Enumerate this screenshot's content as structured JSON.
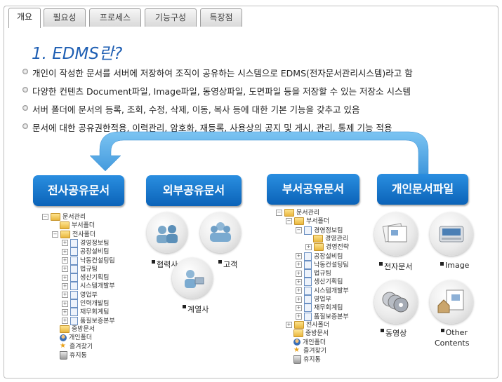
{
  "tabs": [
    "개요",
    "필요성",
    "프로세스",
    "기능구성",
    "특장점"
  ],
  "active_tab": "개요",
  "title": "1. EDMS란?",
  "bullets": [
    "개인이 작성한 문서를 서버에 저장하여 조직이 공유하는 시스템으로 EDMS(전자문서관리시스템)라고 함",
    "다양한 컨텐츠 Document파일, Image파일, 동영상파일, 도면파일 등을 저장할 수 있는 저장소 시스템",
    "서버 폴더에 문서의 등록, 조회, 수정, 삭제, 이동, 복사 등에 대한 기본 기능을 갖추고 있음",
    "문서에 대한 공유권한적용, 이력관리, 암호화, 재등록, 사용상의 공지 및 게시, 관리, 통제 기능 적용"
  ],
  "boxes": {
    "company": "전사공유문서",
    "external": "외부공유문서",
    "dept": "부서공유문서",
    "personal": "개인문서파일"
  },
  "external_items": {
    "partner": "협력사",
    "customer": "고객",
    "affiliate": "계열사"
  },
  "personal_items": {
    "edoc": "전자문서",
    "image": "Image",
    "video": "동영상",
    "other1": "Other",
    "other2": "Contents"
  },
  "tree_company": [
    {
      "label": "문서관리",
      "icon": "folder",
      "exp": "minus"
    },
    {
      "label": "부서폴더",
      "icon": "folder",
      "exp": ""
    },
    {
      "label": "전사폴더",
      "icon": "folder",
      "exp": "minus"
    },
    {
      "label": "경영정보팀",
      "icon": "doc",
      "exp": "plus"
    },
    {
      "label": "공장설비팀",
      "icon": "doc",
      "exp": "plus"
    },
    {
      "label": "낙동컨설팅팀",
      "icon": "doc",
      "exp": "plus"
    },
    {
      "label": "법규팀",
      "icon": "doc",
      "exp": "plus"
    },
    {
      "label": "생산기획팀",
      "icon": "doc",
      "exp": "plus"
    },
    {
      "label": "시스템개발부",
      "icon": "doc",
      "exp": "plus"
    },
    {
      "label": "영업부",
      "icon": "doc",
      "exp": "plus"
    },
    {
      "label": "인력개발팀",
      "icon": "doc",
      "exp": "plus"
    },
    {
      "label": "재무회계팀",
      "icon": "doc",
      "exp": "plus"
    },
    {
      "label": "품질보증본부",
      "icon": "doc",
      "exp": "plus"
    },
    {
      "label": "중방문서",
      "icon": "folder",
      "exp": ""
    },
    {
      "label": "개인폴더",
      "icon": "person",
      "exp": ""
    },
    {
      "label": "즐겨찾기",
      "icon": "star",
      "exp": ""
    },
    {
      "label": "휴지통",
      "icon": "bin",
      "exp": ""
    }
  ],
  "tree_dept": [
    {
      "label": "문서관리",
      "icon": "folder",
      "exp": "minus"
    },
    {
      "label": "부서폴더",
      "icon": "folder",
      "exp": "minus"
    },
    {
      "label": "경영정보팀",
      "icon": "doc",
      "exp": "minus"
    },
    {
      "label": "경영관리",
      "icon": "folder",
      "exp": ""
    },
    {
      "label": "경영전략",
      "icon": "folder",
      "exp": "plus"
    },
    {
      "label": "공장설비팀",
      "icon": "doc",
      "exp": "plus"
    },
    {
      "label": "낙동컨설팅팀",
      "icon": "doc",
      "exp": "plus"
    },
    {
      "label": "법규팀",
      "icon": "doc",
      "exp": "plus"
    },
    {
      "label": "생산기획팀",
      "icon": "doc",
      "exp": "plus"
    },
    {
      "label": "시스템개발부",
      "icon": "doc",
      "exp": "plus"
    },
    {
      "label": "영업부",
      "icon": "doc",
      "exp": "plus"
    },
    {
      "label": "재무회계팀",
      "icon": "doc",
      "exp": "plus"
    },
    {
      "label": "품질보증본부",
      "icon": "doc",
      "exp": "plus"
    },
    {
      "label": "전사폴더",
      "icon": "folder",
      "exp": "plus"
    },
    {
      "label": "중방문서",
      "icon": "folder",
      "exp": ""
    },
    {
      "label": "개인폴더",
      "icon": "person",
      "exp": ""
    },
    {
      "label": "즐겨찾기",
      "icon": "star",
      "exp": ""
    },
    {
      "label": "휴지통",
      "icon": "bin",
      "exp": ""
    }
  ],
  "colors": {
    "accent": "#1f5fb3",
    "button": "#0b63b8",
    "arrow": "#5aaee8"
  }
}
